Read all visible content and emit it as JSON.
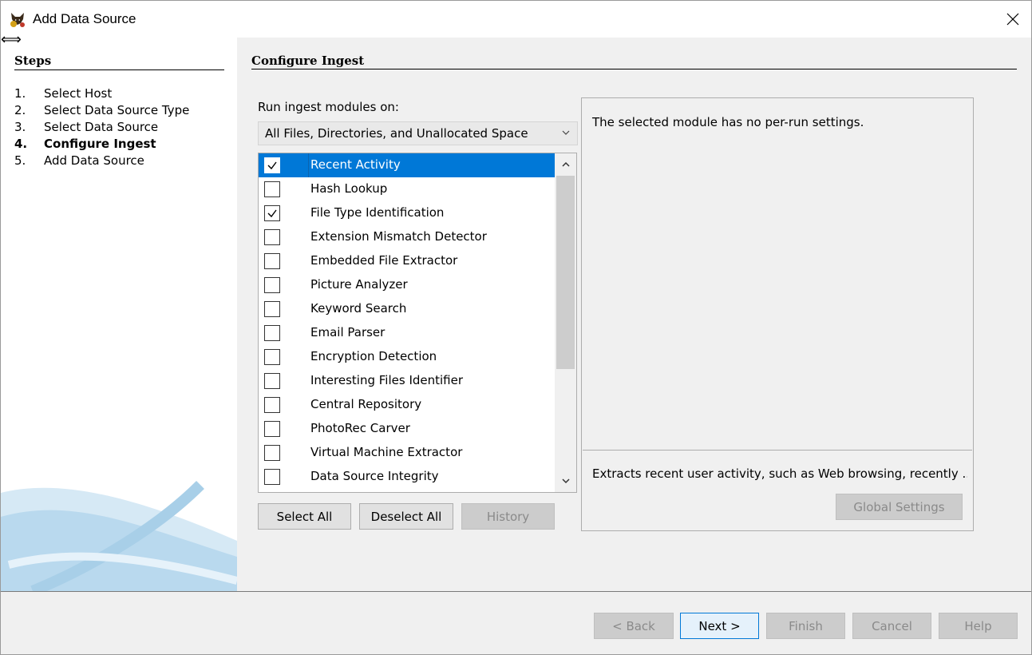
{
  "window": {
    "title": "Add Data Source",
    "icon": "autopsy-dog-icon",
    "resize_glyph": "⟺"
  },
  "steps": {
    "title": "Steps",
    "items": [
      {
        "num": "1.",
        "label": "Select Host",
        "current": false
      },
      {
        "num": "2.",
        "label": "Select Data Source Type",
        "current": false
      },
      {
        "num": "3.",
        "label": "Select Data Source",
        "current": false
      },
      {
        "num": "4.",
        "label": "Configure Ingest",
        "current": true
      },
      {
        "num": "5.",
        "label": "Add Data Source",
        "current": false
      }
    ]
  },
  "content": {
    "title": "Configure Ingest",
    "run_label": "Run ingest modules on:",
    "run_on_selected": "All Files, Directories, and Unallocated Space"
  },
  "modules": [
    {
      "label": "Recent Activity",
      "checked": true,
      "selected": true
    },
    {
      "label": "Hash Lookup",
      "checked": false,
      "selected": false
    },
    {
      "label": "File Type Identification",
      "checked": true,
      "selected": false
    },
    {
      "label": "Extension Mismatch Detector",
      "checked": false,
      "selected": false
    },
    {
      "label": "Embedded File Extractor",
      "checked": false,
      "selected": false
    },
    {
      "label": "Picture Analyzer",
      "checked": false,
      "selected": false
    },
    {
      "label": "Keyword Search",
      "checked": false,
      "selected": false
    },
    {
      "label": "Email Parser",
      "checked": false,
      "selected": false
    },
    {
      "label": "Encryption Detection",
      "checked": false,
      "selected": false
    },
    {
      "label": "Interesting Files Identifier",
      "checked": false,
      "selected": false
    },
    {
      "label": "Central Repository",
      "checked": false,
      "selected": false
    },
    {
      "label": "PhotoRec Carver",
      "checked": false,
      "selected": false
    },
    {
      "label": "Virtual Machine Extractor",
      "checked": false,
      "selected": false
    },
    {
      "label": "Data Source Integrity",
      "checked": false,
      "selected": false
    }
  ],
  "module_buttons": {
    "select_all": "Select All",
    "deselect_all": "Deselect All",
    "history": "History"
  },
  "settings": {
    "message": "The selected module has no per-run settings.",
    "description": "Extracts recent user activity, such as Web browsing, recently ...",
    "global_settings": "Global Settings"
  },
  "nav": {
    "back": "< Back",
    "next": "Next >",
    "finish": "Finish",
    "cancel": "Cancel",
    "help": "Help"
  },
  "colors": {
    "selection": "#0078d7",
    "panel": "#f0f0f0",
    "disabled_text": "#8a8a8a"
  }
}
